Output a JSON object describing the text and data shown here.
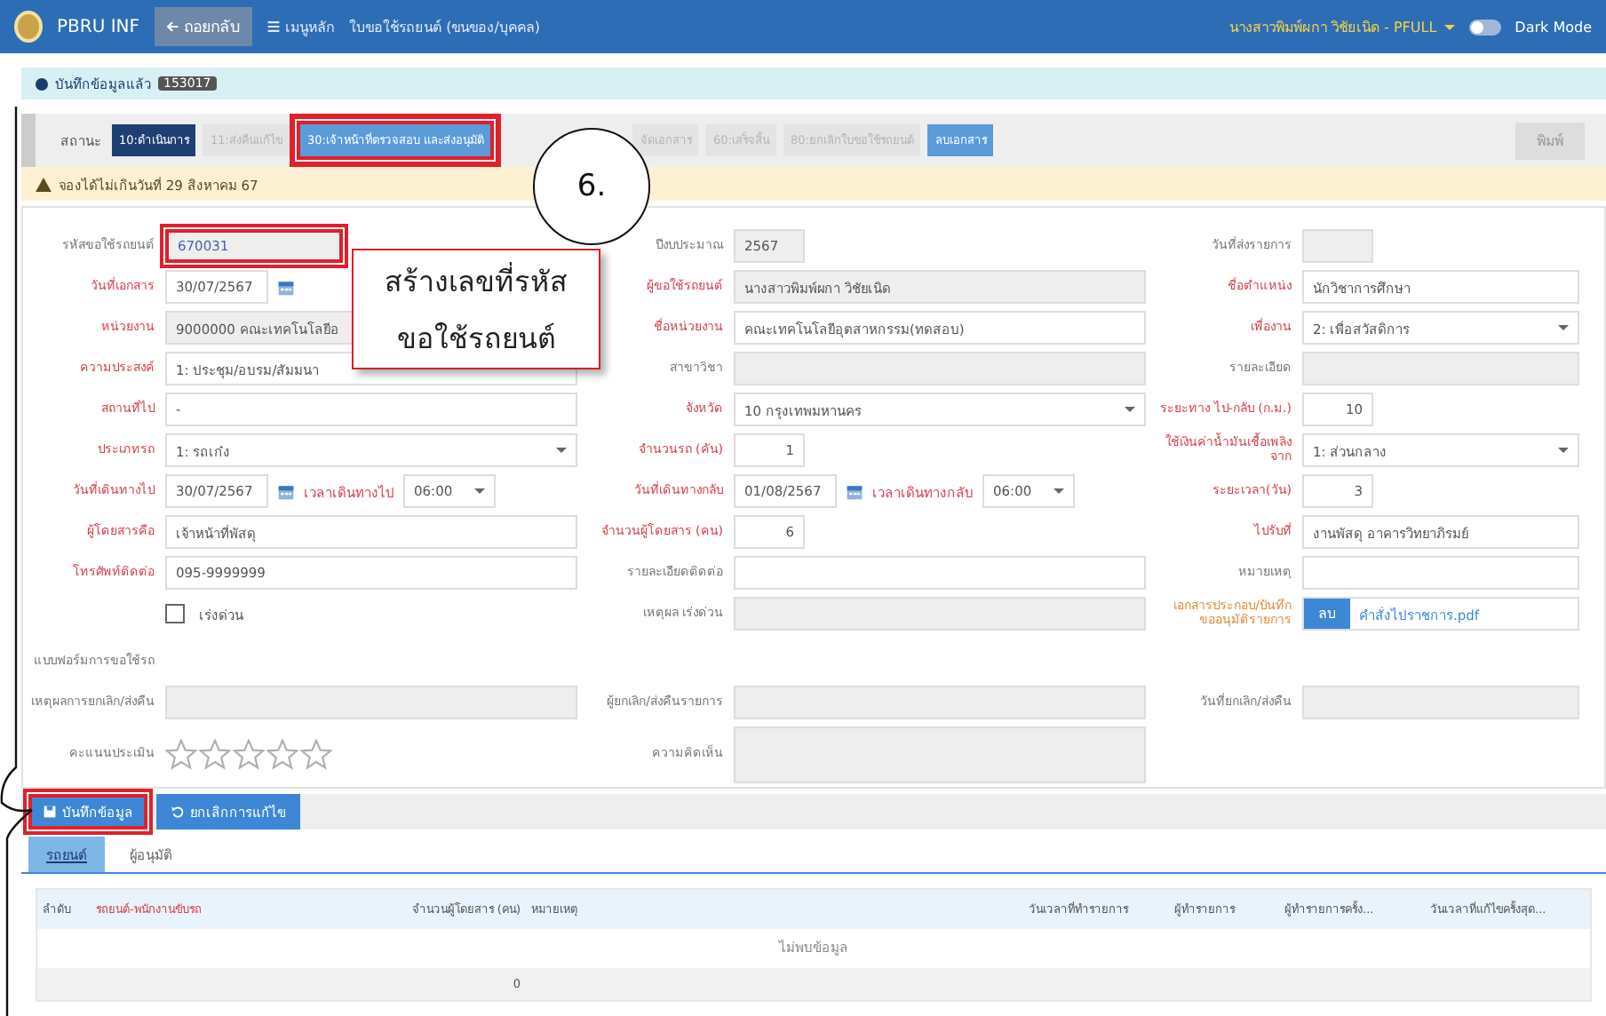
{
  "header": {
    "app_name": "PBRU INF",
    "back_button": "ถอยกลับ",
    "menu_link": "เมนูหลัก",
    "page_title": "ใบขอใช้รถยนต์ (ขนของ/บุคคล)",
    "user": "นางสาวพิมพ์ผกา วิชัยเนิด - PFULL",
    "dark_mode": {
      "label": "Dark Mode",
      "on": false
    }
  },
  "saved_notice": {
    "text": "บันทึกข้อมูลแล้ว",
    "badge": "153017"
  },
  "status": {
    "label": "สถานะ",
    "steps": [
      {
        "label": "10:ดำเนินการ",
        "selected": true,
        "disabled": false,
        "highlighted": false
      },
      {
        "label": "11:ส่งคืนแก้ไข",
        "selected": false,
        "disabled": true,
        "highlighted": false
      },
      {
        "label": "30:เจ้าหน้าที่ตรวจสอบ และส่งอนุมัติ",
        "selected": false,
        "disabled": false,
        "highlighted": true
      },
      {
        "label": "จัดเอกสาร",
        "selected": false,
        "disabled": true,
        "highlighted": false
      },
      {
        "label": "60:เสร็จสิ้น",
        "selected": false,
        "disabled": true,
        "highlighted": false
      },
      {
        "label": "80:ยกเลิกใบขอใช้รถยนต์",
        "selected": false,
        "disabled": true,
        "highlighted": false
      }
    ],
    "delete_button": "ลบเอกสาร",
    "print_button": {
      "label": "พิมพ์",
      "disabled": true
    }
  },
  "warning": "จองได้ไม่เกินวันที่ 29 สิงหาคม 67",
  "callouts": [
    {
      "kind": "circle",
      "text": "6."
    },
    {
      "kind": "box",
      "text": "สร้างเลขที่รหัส ขอใช้รถยนต์"
    }
  ],
  "form": {
    "rows": [
      [
        {
          "label": "รหัสขอใช้รถยนต์",
          "required": false,
          "kind": "code",
          "value": "670031",
          "highlighted": true
        },
        {
          "label": "ปีงบประมาณ",
          "required": false,
          "kind": "short",
          "value": "2567",
          "disabled": true
        },
        {
          "label": "วันที่ส่งรายการ",
          "required": false,
          "kind": "short",
          "disabled": true
        }
      ],
      [
        {
          "label": "วันที่เอกสาร",
          "required": true,
          "kind": "date",
          "value": "30/07/2567"
        },
        {
          "label": "ผู้ขอใช้รถยนต์",
          "required": true,
          "kind": "text",
          "value": "นางสาวพิมพ์ผกา วิชัยเนิด",
          "disabled": true
        },
        {
          "label": "ชื่อตำแหน่ง",
          "required": true,
          "kind": "text",
          "value": "นักวิชาการศึกษา",
          "disabled": false
        }
      ],
      [
        {
          "label": "หน่วยงาน",
          "required": true,
          "kind": "text",
          "value": "9000000 คณะเทคโนโลยีอ",
          "disabled": true
        },
        {
          "label": "ชื่อหน่วยงาน",
          "required": true,
          "kind": "text",
          "value": "คณะเทคโนโลยีอุตสาหกรรม(ทดสอบ)",
          "disabled": false
        },
        {
          "label": "เพื่องาน",
          "required": true,
          "kind": "select",
          "value": "2: เพื่อสวัสดิการ"
        }
      ],
      [
        {
          "label": "ความประสงค์",
          "required": true,
          "kind": "text",
          "value": "1: ประชุม/อบรม/สัมมนา",
          "disabled": false
        },
        {
          "label": "สาขาวิชา",
          "required": false,
          "kind": "text",
          "disabled": true
        },
        {
          "label": "รายละเอียด",
          "required": false,
          "kind": "text",
          "disabled": true
        }
      ],
      [
        {
          "label": "สถานที่ไป",
          "required": true,
          "kind": "text",
          "value": "-",
          "disabled": false
        },
        {
          "label": "จังหวัด",
          "required": true,
          "kind": "select",
          "value": "10 กรุงเทพมหานคร"
        },
        {
          "label": "ระยะทาง ไป-กลับ (ก.ม.)",
          "required": true,
          "kind": "number",
          "value": "10",
          "disabled": false
        }
      ],
      [
        {
          "label": "ประเภทรถ",
          "required": true,
          "kind": "select",
          "value": "1: รถเก๋ง"
        },
        {
          "label": "จำนวนรถ (คัน)",
          "required": true,
          "kind": "number",
          "value": "1",
          "disabled": false
        },
        {
          "label": "ใช้เงินค่าน้ำมันเชื้อเพลิงจาก",
          "required": true,
          "kind": "select",
          "value": "1: ส่วนกลาง"
        }
      ],
      [
        {
          "label": "วันที่เดินทางไป",
          "required": true,
          "kind": "datetime",
          "value": "30/07/2567",
          "time_label": "เวลาเดินทางไป",
          "time": "06:00"
        },
        {
          "label": "วันที่เดินทางกลับ",
          "required": true,
          "kind": "datetime",
          "value": "01/08/2567",
          "time_label": "เวลาเดินทางกลับ",
          "time": "06:00"
        },
        {
          "label": "ระยะเวลา(วัน)",
          "required": true,
          "kind": "number",
          "value": "3",
          "disabled": false
        }
      ],
      [
        {
          "label": "ผู้โดยสารคือ",
          "required": true,
          "kind": "text",
          "value": "เจ้าหน้าที่พัสดุ",
          "disabled": false
        },
        {
          "label": "จำนวนผู้โดยสาร (คน)",
          "required": true,
          "kind": "number",
          "value": "6",
          "disabled": false
        },
        {
          "label": "ไปรับที่",
          "required": true,
          "kind": "text",
          "value": "งานพัสดุ อาคารวิทยาภิรมย์",
          "disabled": false
        }
      ],
      [
        {
          "label": "โทรศัพท์ติดต่อ",
          "required": true,
          "kind": "text",
          "value": "095-9999999",
          "disabled": false
        },
        {
          "label": "รายละเอียดติดต่อ",
          "required": false,
          "kind": "text",
          "disabled": false
        },
        {
          "label": "หมายเหตุ",
          "required": false,
          "kind": "text",
          "disabled": false
        }
      ],
      [
        {
          "kind": "checkbox",
          "value": "เร่งด่วน",
          "checked": false
        },
        {
          "label": "เหตุผล เร่งด่วน",
          "required": false,
          "kind": "text",
          "disabled": true
        },
        {
          "label": "เอกสารประกอบ/บันทึกขออนุมัติรายการ",
          "required": true,
          "kind": "file",
          "button": "ลบ",
          "value": "คำสั่งไปราชการ.pdf"
        }
      ]
    ],
    "section_label": "แบบฟอร์มการขอใช้รถ",
    "lower_rows": [
      [
        {
          "label": "เหตุผลการยกเลิก/ส่งคืน",
          "required": false,
          "kind": "text",
          "disabled": true
        },
        {
          "label": "ผู้ยกเลิก/ส่งคืนรายการ",
          "required": false,
          "kind": "text",
          "disabled": true
        },
        {
          "label": "วันที่ยกเลิก/ส่งคืน",
          "required": false,
          "kind": "text",
          "disabled": true
        }
      ],
      [
        {
          "label": "คะแนนประเมิน",
          "required": false,
          "kind": "stars",
          "stars": 0
        },
        {
          "label": "ความคิดเห็น",
          "required": false,
          "kind": "textarea",
          "disabled": true
        }
      ]
    ]
  },
  "actions": [
    {
      "kind": "save",
      "label": "บันทึกข้อมูล",
      "highlighted": true
    },
    {
      "kind": "undo",
      "label": "ยกเลิกการแก้ไข",
      "highlighted": false
    }
  ],
  "tabs": [
    {
      "label": "รถยนต์",
      "selected": true
    },
    {
      "label": "ผู้อนุมัติ",
      "selected": false
    }
  ],
  "table": {
    "columns": [
      {
        "label": "ลำดับ",
        "required": false
      },
      {
        "label": "รถยนต์-พนักงานขับรถ",
        "required": true
      },
      {
        "label": "จำนวนผู้โดยสาร (คน)",
        "required": false
      },
      {
        "label": "หมายเหตุ",
        "required": false
      },
      {
        "label": "วันเวลาที่ทำรายการ",
        "required": false
      },
      {
        "label": "ผู้ทำรายการ",
        "required": false
      },
      {
        "label": "ผู้ทำรายการครั้ง...",
        "required": false
      },
      {
        "label": "วันเวลาที่แก้ไขครั้งสุด...",
        "required": false
      }
    ],
    "empty_message": "ไม่พบข้อมูล",
    "footer_total": "0"
  }
}
